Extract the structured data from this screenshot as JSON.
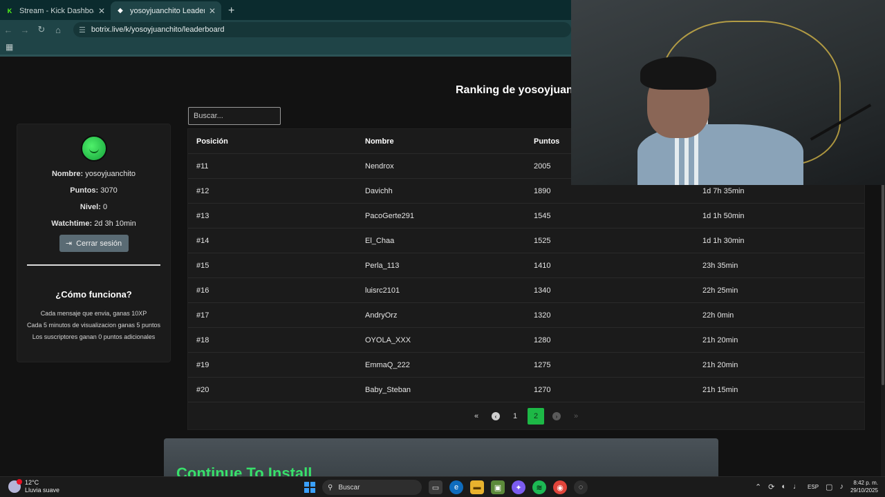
{
  "browser": {
    "tabs": [
      {
        "title": "Stream - Kick Dashboard",
        "icon": "kick-icon"
      },
      {
        "title": "yosoyjuanchito LeaderBoard | T",
        "icon": "botrix-icon"
      }
    ],
    "url": "botrix.live/k/yosoyjuanchito/leaderboard"
  },
  "page": {
    "ranking_title": "Ranking de yosoyjuanc",
    "search_placeholder": "Buscar...",
    "profile": {
      "name_label": "Nombre:",
      "name_value": "yosoyjuanchito",
      "points_label": "Puntos:",
      "points_value": "3070",
      "level_label": "Nivel:",
      "level_value": "0",
      "watch_label": "Watchtime:",
      "watch_value": "2d 3h 10min",
      "logout_label": "Cerrar sesión"
    },
    "how": {
      "title": "¿Cómo funciona?",
      "lines": [
        "Cada mensaje que envia, ganas 10XP",
        "Cada 5 minutos de visualizacion ganas 5 puntos",
        "Los suscriptores ganan 0 puntos adicionales"
      ]
    },
    "table": {
      "headers": [
        "Posición",
        "Nombre",
        "Puntos",
        ""
      ],
      "rows": [
        [
          "#11",
          "Nendrox",
          "2005",
          ""
        ],
        [
          "#12",
          "Davichh",
          "1890",
          "1d 7h 35min"
        ],
        [
          "#13",
          "PacoGerte291",
          "1545",
          "1d 1h 50min"
        ],
        [
          "#14",
          "El_Chaa",
          "1525",
          "1d 1h 30min"
        ],
        [
          "#15",
          "Perla_113",
          "1410",
          "23h 35min"
        ],
        [
          "#16",
          "luisrc2101",
          "1340",
          "22h 25min"
        ],
        [
          "#17",
          "AndryOrz",
          "1320",
          "22h 0min"
        ],
        [
          "#18",
          "OYOLA_XXX",
          "1280",
          "21h 20min"
        ],
        [
          "#19",
          "EmmaQ_222",
          "1275",
          "21h 20min"
        ],
        [
          "#20",
          "Baby_Steban",
          "1270",
          "21h 15min"
        ]
      ]
    },
    "pagination": {
      "pages": [
        "1",
        "2"
      ],
      "current": "2"
    },
    "install_title": "Continue To Install"
  },
  "taskbar": {
    "weather_temp": "12°C",
    "weather_desc": "Lluvia suave",
    "search_label": "Buscar",
    "lang": "ESP",
    "time": "8:42 p. m.",
    "date": "29/10/2025"
  },
  "colors": {
    "accent": "#1db846",
    "chrome": "#1f4447"
  }
}
